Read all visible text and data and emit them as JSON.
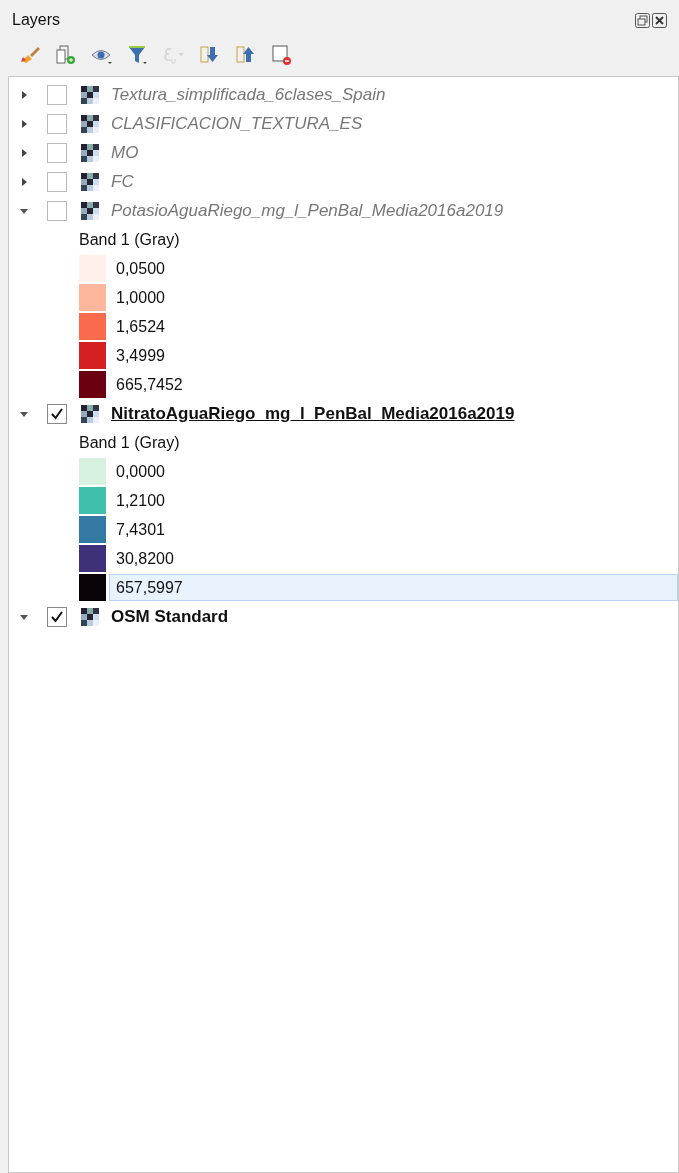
{
  "panel": {
    "title": "Layers"
  },
  "toolbar": [
    {
      "kind": "brush",
      "disabled": false
    },
    {
      "kind": "group",
      "disabled": false
    },
    {
      "kind": "eye",
      "disabled": false
    },
    {
      "kind": "filter",
      "disabled": false
    },
    {
      "kind": "expression",
      "disabled": true
    },
    {
      "kind": "expand",
      "disabled": false
    },
    {
      "kind": "collapse",
      "disabled": false
    },
    {
      "kind": "remove",
      "disabled": false
    }
  ],
  "layers": [
    {
      "name": "Textura_simplificada_6clases_Spain",
      "checked": false,
      "current": false,
      "expanded": false
    },
    {
      "name": "CLASIFICACION_TEXTURA_ES",
      "checked": false,
      "current": false,
      "expanded": false
    },
    {
      "name": "MO",
      "checked": false,
      "current": false,
      "expanded": false
    },
    {
      "name": "FC",
      "checked": false,
      "current": false,
      "expanded": false
    },
    {
      "name": "PotasioAguaRiego_mg_l_PenBal_Media2016a2019",
      "checked": false,
      "current": false,
      "expanded": true,
      "band": "Band 1 (Gray)",
      "legend": [
        {
          "label": "0,0500",
          "color": "#fff0ec",
          "selected": false
        },
        {
          "label": "1,0000",
          "color": "#fcb79c",
          "selected": false
        },
        {
          "label": "1,6524",
          "color": "#f96b4c",
          "selected": false
        },
        {
          "label": "3,4999",
          "color": "#d42020",
          "selected": false
        },
        {
          "label": "665,7452",
          "color": "#6b0010",
          "selected": false
        }
      ]
    },
    {
      "name": "NitratoAguaRiego_mg_l_PenBal_Media2016a2019",
      "checked": true,
      "current": true,
      "expanded": true,
      "band": "Band 1 (Gray)",
      "legend": [
        {
          "label": "0,0000",
          "color": "#d8f2e2",
          "selected": false
        },
        {
          "label": "1,2100",
          "color": "#40c0ac",
          "selected": false
        },
        {
          "label": "7,4301",
          "color": "#3478a4",
          "selected": false
        },
        {
          "label": "30,8200",
          "color": "#40307a",
          "selected": false
        },
        {
          "label": "657,5997",
          "color": "#0a0408",
          "selected": true
        }
      ]
    },
    {
      "name": "OSM Standard",
      "checked": true,
      "current": false,
      "expanded": true
    }
  ]
}
